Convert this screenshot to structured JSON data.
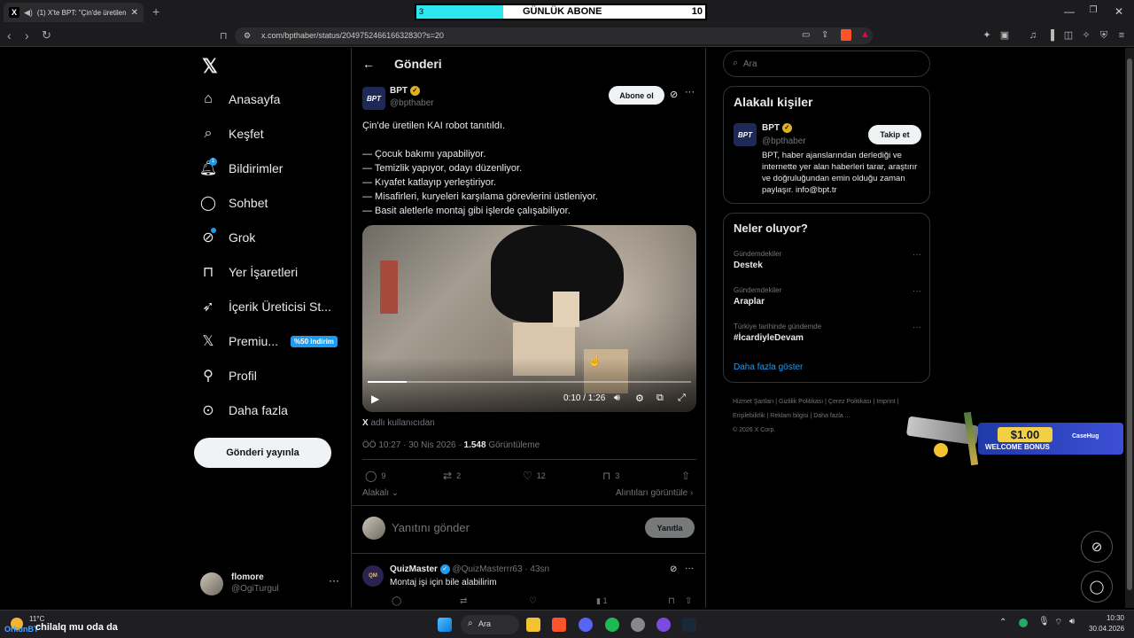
{
  "browser": {
    "tab_title": "(1) X'te BPT: \"Çin'de üretilen K",
    "url": "x.com/bpthaber/status/2049752466166328​30?s=20"
  },
  "sub_widget": {
    "current": "3",
    "label": "GÜNLÜK ABONE",
    "goal": "10",
    "progress": 0.3
  },
  "nav": {
    "items": [
      {
        "label": "Anasayfa",
        "icon": "home-icon"
      },
      {
        "label": "Keşfet",
        "icon": "search-icon"
      },
      {
        "label": "Bildirimler",
        "icon": "bell-icon",
        "badge": "1"
      },
      {
        "label": "Sohbet",
        "icon": "chat-icon"
      },
      {
        "label": "Grok",
        "icon": "grok-icon"
      },
      {
        "label": "Yer İşaretleri",
        "icon": "bookmark-icon"
      },
      {
        "label": "İçerik Üreticisi St...",
        "icon": "rocket-icon"
      },
      {
        "label": "Premiu...",
        "icon": "x-icon",
        "badge": "%50 indirim"
      },
      {
        "label": "Profil",
        "icon": "person-icon"
      },
      {
        "label": "Daha fazla",
        "icon": "more-circle-icon"
      }
    ],
    "post_button": "Gönderi yayınla",
    "user": {
      "name": "flomore",
      "handle": "@OgiTurgul"
    }
  },
  "header": {
    "title": "Gönderi"
  },
  "post": {
    "author": "BPT",
    "handle": "@bpthaber",
    "avatar_text": "BPT",
    "subscribe": "Abone ol",
    "lines": [
      "Çin'de üretilen KAI robot tanıtıldı.",
      "",
      "— Çocuk bakımı yapabiliyor.",
      "— Temizlik yapıyor, odayı düzenliyor.",
      "— Kıyafet katlayıp yerleştiriyor.",
      "— Misafirleri, kuryeleri karşılama görevlerini üstleniyor.",
      "— Basit aletlerle montaj gibi işlerde çalışabiliyor."
    ],
    "video_time": "0:10 / 1:26",
    "video_progress": 0.12,
    "source_x": "X",
    "source_text": " adlı kullanıcıdan",
    "meta_time": "ÖÖ 10:27 · 30 Nis 2026 · ",
    "views": "1.548",
    "views_label": " Görüntüleme",
    "replies": "9",
    "reposts": "2",
    "likes": "12",
    "bookmarks": "3",
    "related": "Alakalı",
    "quotes": "Alıntıları görüntüle"
  },
  "reply_box": {
    "placeholder": "Yanıtını gönder",
    "button": "Yanıtla"
  },
  "reply": {
    "author": "QuizMaster",
    "handle": "@QuizMasterrr63 · 43sn",
    "text": "Montaj işi için bile alabilirim",
    "stats": "1"
  },
  "search": {
    "placeholder": "Ara"
  },
  "related_people": {
    "title": "Alakalı kişiler",
    "name": "BPT",
    "handle": "@bpthaber",
    "follow": "Takip et",
    "bio": "BPT, haber ajanslarından derlediği ve internette yer alan haberleri tarar, araştırır ve doğruluğundan emin olduğu zaman paylaşır. info@bpt.tr"
  },
  "trends": {
    "title": "Neler oluyor?",
    "items": [
      {
        "category": "Gündemdekiler",
        "name": "Destek"
      },
      {
        "category": "Gündemdekiler",
        "name": "Araplar"
      },
      {
        "category": "Türkiye tarihinde gündemde",
        "name": "#İcardiyleDevam"
      }
    ],
    "more": "Daha fazla göster"
  },
  "footer": {
    "links": [
      "Hizmet Şartları",
      "Gizlilik Politikası",
      "Çerez Politikası",
      "Imprint",
      "Erişilebilirlik",
      "Reklam bilgisi",
      "Daha fazla ..."
    ],
    "copyright": "© 2026 X Corp."
  },
  "ad": {
    "amount": "$1.00",
    "label": "WELCOME BONUS",
    "brand": "CaseHug"
  },
  "overlay_text": "chilalq mu oda da",
  "taskbar": {
    "weather": "11°C",
    "weather_user": "OrkunBT",
    "search": "Ara",
    "time": "10:30",
    "date": "30.04.2026"
  }
}
